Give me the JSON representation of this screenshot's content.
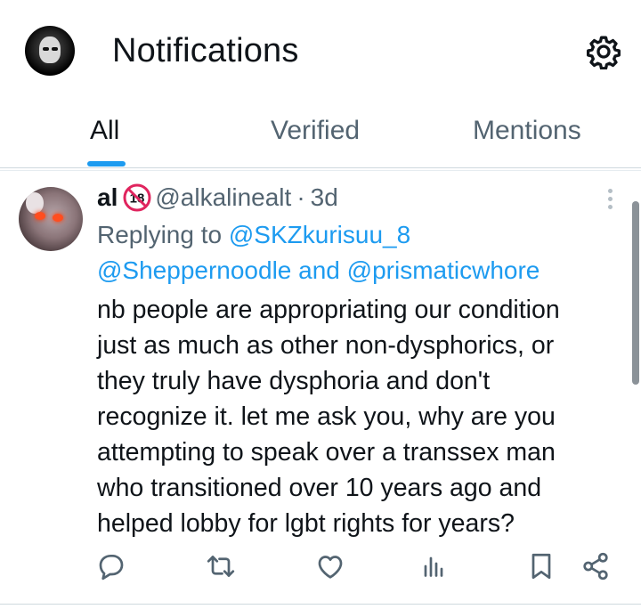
{
  "header": {
    "title": "Notifications",
    "avatar_icon": "profile-avatar",
    "settings_icon": "gear-icon"
  },
  "tabs": [
    {
      "label": "All",
      "active": true
    },
    {
      "label": "Verified",
      "active": false
    },
    {
      "label": "Mentions",
      "active": false
    }
  ],
  "post": {
    "display_name": "al",
    "handle": "@alkalinealt",
    "separator": "·",
    "time": "3d",
    "reply_prefix": "Replying to ",
    "reply_to": [
      "@SKZkurisuu_8",
      "@Sheppernoodle",
      "@prismaticwhore"
    ],
    "reply_joiner": " and ",
    "text_lines": [
      "nb people are appropriating our condition",
      "just as much as other non-dysphorics, or",
      "they truly have dysphoria and don't",
      "recognize it. let me ask you, why are you",
      "attempting to speak over a transsex man",
      "who transitioned over 10 years ago and",
      "helped lobby for lgbt rights for years?"
    ]
  },
  "actions": [
    "reply-icon",
    "retweet-icon",
    "like-icon",
    "views-icon",
    "bookmark-icon",
    "share-icon"
  ],
  "colors": {
    "accent": "#1d9bf0",
    "text_primary": "#0f1419",
    "text_secondary": "#536471",
    "divider": "#cfd9de",
    "badge_red": "#e0245e"
  }
}
